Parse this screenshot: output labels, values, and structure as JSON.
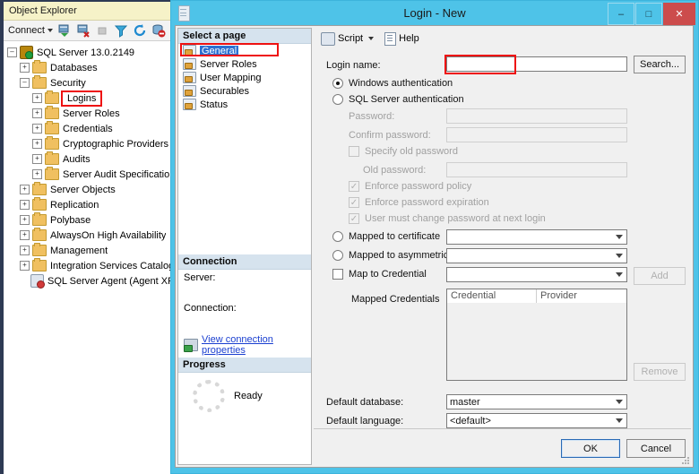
{
  "object_explorer": {
    "title": "Object Explorer",
    "toolbar": {
      "connect_label": "Connect",
      "icons": [
        "connect-server-icon",
        "disconnect-server-icon",
        "stop-icon",
        "filter-icon",
        "refresh-icon",
        "disconnect-all-icon"
      ]
    },
    "tree": [
      {
        "label": "SQL Server 13.0.2149",
        "level": 0,
        "expander": "minus",
        "icon": "server-icon",
        "highlight": false
      },
      {
        "label": "Databases",
        "level": 1,
        "expander": "plus",
        "icon": "folder-icon",
        "highlight": false
      },
      {
        "label": "Security",
        "level": 1,
        "expander": "minus",
        "icon": "folder-icon",
        "highlight": false
      },
      {
        "label": "Logins",
        "level": 2,
        "expander": "plus",
        "icon": "folder-icon",
        "highlight": true
      },
      {
        "label": "Server Roles",
        "level": 2,
        "expander": "plus",
        "icon": "folder-icon",
        "highlight": false
      },
      {
        "label": "Credentials",
        "level": 2,
        "expander": "plus",
        "icon": "folder-icon",
        "highlight": false
      },
      {
        "label": "Cryptographic Providers",
        "level": 2,
        "expander": "plus",
        "icon": "folder-icon",
        "highlight": false
      },
      {
        "label": "Audits",
        "level": 2,
        "expander": "plus",
        "icon": "folder-icon",
        "highlight": false
      },
      {
        "label": "Server Audit Specification",
        "level": 2,
        "expander": "plus",
        "icon": "folder-icon",
        "highlight": false
      },
      {
        "label": "Server Objects",
        "level": 1,
        "expander": "plus",
        "icon": "folder-icon",
        "highlight": false
      },
      {
        "label": "Replication",
        "level": 1,
        "expander": "plus",
        "icon": "folder-icon",
        "highlight": false
      },
      {
        "label": "Polybase",
        "level": 1,
        "expander": "plus",
        "icon": "folder-icon",
        "highlight": false
      },
      {
        "label": "AlwaysOn High Availability",
        "level": 1,
        "expander": "plus",
        "icon": "folder-icon",
        "highlight": false
      },
      {
        "label": "Management",
        "level": 1,
        "expander": "plus",
        "icon": "folder-icon",
        "highlight": false
      },
      {
        "label": "Integration Services Catalogs",
        "level": 1,
        "expander": "plus",
        "icon": "folder-icon",
        "highlight": false
      },
      {
        "label": "SQL Server Agent (Agent XPs",
        "level": 1,
        "expander": "none",
        "icon": "agent-icon",
        "highlight": false
      }
    ]
  },
  "dialog": {
    "title": "Login - New",
    "icon": "dialog-server-icon",
    "window_buttons": {
      "minimize": "–",
      "maximize": "□",
      "close": "✕"
    },
    "pages": {
      "header": "Select a page",
      "items": [
        {
          "label": "General",
          "selected": true
        },
        {
          "label": "Server Roles",
          "selected": false
        },
        {
          "label": "User Mapping",
          "selected": false
        },
        {
          "label": "Securables",
          "selected": false
        },
        {
          "label": "Status",
          "selected": false
        }
      ]
    },
    "connection": {
      "header": "Connection",
      "server_label": "Server:",
      "server_value": "",
      "connection_label": "Connection:",
      "connection_value": "",
      "view_properties_link": "View connection properties"
    },
    "progress": {
      "header": "Progress",
      "status": "Ready"
    },
    "script_bar": {
      "script_label": "Script",
      "help_label": "Help"
    },
    "form": {
      "login_name_label": "Login name:",
      "login_name_value": "",
      "search_button": "Search...",
      "windows_auth_label": "Windows authentication",
      "windows_auth_selected": true,
      "sql_auth_label": "SQL Server authentication",
      "sql_auth_selected": false,
      "password_label": "Password:",
      "password_value": "",
      "confirm_password_label": "Confirm password:",
      "confirm_password_value": "",
      "specify_old_password_label": "Specify old password",
      "specify_old_password_checked": false,
      "old_password_label": "Old password:",
      "old_password_value": "",
      "enforce_policy_label": "Enforce password policy",
      "enforce_policy_checked": true,
      "enforce_expiration_label": "Enforce password expiration",
      "enforce_expiration_checked": true,
      "must_change_label": "User must change password at next login",
      "must_change_checked": true,
      "mapped_certificate_label": "Mapped to certificate",
      "mapped_certificate_selected": false,
      "mapped_certificate_value": "",
      "mapped_asymmetric_label": "Mapped to asymmetric key",
      "mapped_asymmetric_selected": false,
      "mapped_asymmetric_value": "",
      "map_credential_label": "Map to Credential",
      "map_credential_checked": false,
      "map_credential_value": "",
      "add_button": "Add",
      "mapped_credentials_label": "Mapped Credentials",
      "grid_columns": [
        "Credential",
        "Provider"
      ],
      "grid_rows": [],
      "remove_button": "Remove",
      "default_database_label": "Default database:",
      "default_database_value": "master",
      "default_language_label": "Default language:",
      "default_language_value": "<default>"
    },
    "footer": {
      "ok_button": "OK",
      "cancel_button": "Cancel"
    }
  },
  "colors": {
    "title_bar": "#4ec3e8",
    "close_button": "#cc4c4c",
    "highlight_red": "#ee1111",
    "selection_blue": "#2b6fd1",
    "oe_title_bar": "#f6f2c8",
    "pane_header": "#d6e3ee",
    "link": "#1a3fd0"
  }
}
